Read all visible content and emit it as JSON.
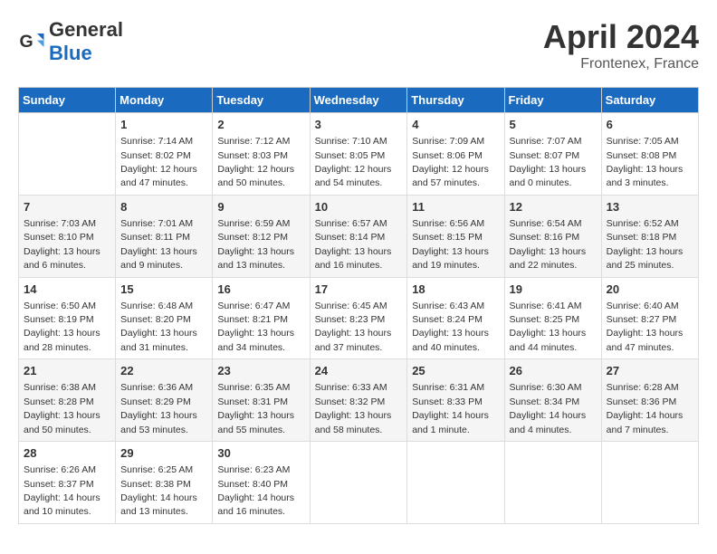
{
  "header": {
    "logo_general": "General",
    "logo_blue": "Blue",
    "month_title": "April 2024",
    "location": "Frontenex, France"
  },
  "weekdays": [
    "Sunday",
    "Monday",
    "Tuesday",
    "Wednesday",
    "Thursday",
    "Friday",
    "Saturday"
  ],
  "weeks": [
    [
      {
        "day": "",
        "info": ""
      },
      {
        "day": "1",
        "info": "Sunrise: 7:14 AM\nSunset: 8:02 PM\nDaylight: 12 hours\nand 47 minutes."
      },
      {
        "day": "2",
        "info": "Sunrise: 7:12 AM\nSunset: 8:03 PM\nDaylight: 12 hours\nand 50 minutes."
      },
      {
        "day": "3",
        "info": "Sunrise: 7:10 AM\nSunset: 8:05 PM\nDaylight: 12 hours\nand 54 minutes."
      },
      {
        "day": "4",
        "info": "Sunrise: 7:09 AM\nSunset: 8:06 PM\nDaylight: 12 hours\nand 57 minutes."
      },
      {
        "day": "5",
        "info": "Sunrise: 7:07 AM\nSunset: 8:07 PM\nDaylight: 13 hours\nand 0 minutes."
      },
      {
        "day": "6",
        "info": "Sunrise: 7:05 AM\nSunset: 8:08 PM\nDaylight: 13 hours\nand 3 minutes."
      }
    ],
    [
      {
        "day": "7",
        "info": "Sunrise: 7:03 AM\nSunset: 8:10 PM\nDaylight: 13 hours\nand 6 minutes."
      },
      {
        "day": "8",
        "info": "Sunrise: 7:01 AM\nSunset: 8:11 PM\nDaylight: 13 hours\nand 9 minutes."
      },
      {
        "day": "9",
        "info": "Sunrise: 6:59 AM\nSunset: 8:12 PM\nDaylight: 13 hours\nand 13 minutes."
      },
      {
        "day": "10",
        "info": "Sunrise: 6:57 AM\nSunset: 8:14 PM\nDaylight: 13 hours\nand 16 minutes."
      },
      {
        "day": "11",
        "info": "Sunrise: 6:56 AM\nSunset: 8:15 PM\nDaylight: 13 hours\nand 19 minutes."
      },
      {
        "day": "12",
        "info": "Sunrise: 6:54 AM\nSunset: 8:16 PM\nDaylight: 13 hours\nand 22 minutes."
      },
      {
        "day": "13",
        "info": "Sunrise: 6:52 AM\nSunset: 8:18 PM\nDaylight: 13 hours\nand 25 minutes."
      }
    ],
    [
      {
        "day": "14",
        "info": "Sunrise: 6:50 AM\nSunset: 8:19 PM\nDaylight: 13 hours\nand 28 minutes."
      },
      {
        "day": "15",
        "info": "Sunrise: 6:48 AM\nSunset: 8:20 PM\nDaylight: 13 hours\nand 31 minutes."
      },
      {
        "day": "16",
        "info": "Sunrise: 6:47 AM\nSunset: 8:21 PM\nDaylight: 13 hours\nand 34 minutes."
      },
      {
        "day": "17",
        "info": "Sunrise: 6:45 AM\nSunset: 8:23 PM\nDaylight: 13 hours\nand 37 minutes."
      },
      {
        "day": "18",
        "info": "Sunrise: 6:43 AM\nSunset: 8:24 PM\nDaylight: 13 hours\nand 40 minutes."
      },
      {
        "day": "19",
        "info": "Sunrise: 6:41 AM\nSunset: 8:25 PM\nDaylight: 13 hours\nand 44 minutes."
      },
      {
        "day": "20",
        "info": "Sunrise: 6:40 AM\nSunset: 8:27 PM\nDaylight: 13 hours\nand 47 minutes."
      }
    ],
    [
      {
        "day": "21",
        "info": "Sunrise: 6:38 AM\nSunset: 8:28 PM\nDaylight: 13 hours\nand 50 minutes."
      },
      {
        "day": "22",
        "info": "Sunrise: 6:36 AM\nSunset: 8:29 PM\nDaylight: 13 hours\nand 53 minutes."
      },
      {
        "day": "23",
        "info": "Sunrise: 6:35 AM\nSunset: 8:31 PM\nDaylight: 13 hours\nand 55 minutes."
      },
      {
        "day": "24",
        "info": "Sunrise: 6:33 AM\nSunset: 8:32 PM\nDaylight: 13 hours\nand 58 minutes."
      },
      {
        "day": "25",
        "info": "Sunrise: 6:31 AM\nSunset: 8:33 PM\nDaylight: 14 hours\nand 1 minute."
      },
      {
        "day": "26",
        "info": "Sunrise: 6:30 AM\nSunset: 8:34 PM\nDaylight: 14 hours\nand 4 minutes."
      },
      {
        "day": "27",
        "info": "Sunrise: 6:28 AM\nSunset: 8:36 PM\nDaylight: 14 hours\nand 7 minutes."
      }
    ],
    [
      {
        "day": "28",
        "info": "Sunrise: 6:26 AM\nSunset: 8:37 PM\nDaylight: 14 hours\nand 10 minutes."
      },
      {
        "day": "29",
        "info": "Sunrise: 6:25 AM\nSunset: 8:38 PM\nDaylight: 14 hours\nand 13 minutes."
      },
      {
        "day": "30",
        "info": "Sunrise: 6:23 AM\nSunset: 8:40 PM\nDaylight: 14 hours\nand 16 minutes."
      },
      {
        "day": "",
        "info": ""
      },
      {
        "day": "",
        "info": ""
      },
      {
        "day": "",
        "info": ""
      },
      {
        "day": "",
        "info": ""
      }
    ]
  ]
}
